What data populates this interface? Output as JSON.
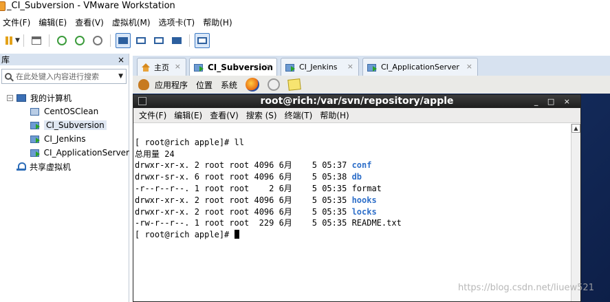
{
  "window": {
    "title": "_CI_Subversion - VMware Workstation"
  },
  "menu": [
    "文件(F)",
    "编辑(E)",
    "查看(V)",
    "虚拟机(M)",
    "选项卡(T)",
    "帮助(H)"
  ],
  "toolbar": {
    "icons": [
      "pause-icon",
      "network-icon",
      "snapshot-icon",
      "revert-snapshot-icon",
      "snapshot-manager-icon",
      "show-library-icon",
      "console-view-icon",
      "full-screen-icon",
      "unity-icon",
      "thumbnail-icon"
    ]
  },
  "library": {
    "title": "库",
    "close_glyph": "×",
    "search_placeholder": "在此处键入内容进行搜索",
    "tree": {
      "root": "我的计算机",
      "root_toggle": "−",
      "vms": [
        "CentOSClean",
        "CI_Subversion",
        "CI_Jenkins",
        "CI_ApplicationServer"
      ],
      "shared": "共享虚拟机"
    }
  },
  "tabs": [
    {
      "label": "主页"
    },
    {
      "label": "CI_Subversion"
    },
    {
      "label": "CI_Jenkins"
    },
    {
      "label": "CI_ApplicationServer"
    }
  ],
  "tab_close_glyph": "×",
  "guest_panel": {
    "applications": "应用程序",
    "places": "位置",
    "system": "系统"
  },
  "terminal": {
    "title": "root@rich:/var/svn/repository/apple",
    "controls": "_ □ ×",
    "menu": [
      "文件(F)",
      "编辑(E)",
      "查看(V)",
      "搜索 (S)",
      "终端(T)",
      "帮助(H)"
    ],
    "prompt1": "[ root@rich apple]# ll",
    "total": "总用量 24",
    "rows": [
      {
        "perms": "drwxr-xr-x.",
        "links": "2",
        "owner": "root",
        "group": "root",
        "size": "4096",
        "month": "6月",
        "day": "5",
        "time": "05:37",
        "name": "conf",
        "is_dir": true
      },
      {
        "perms": "drwxr-sr-x.",
        "links": "6",
        "owner": "root",
        "group": "root",
        "size": "4096",
        "month": "6月",
        "day": "5",
        "time": "05:38",
        "name": "db",
        "is_dir": true
      },
      {
        "perms": "-r--r--r--.",
        "links": "1",
        "owner": "root",
        "group": "root",
        "size": "2",
        "month": "6月",
        "day": "5",
        "time": "05:35",
        "name": "format",
        "is_dir": false
      },
      {
        "perms": "drwxr-xr-x.",
        "links": "2",
        "owner": "root",
        "group": "root",
        "size": "4096",
        "month": "6月",
        "day": "5",
        "time": "05:35",
        "name": "hooks",
        "is_dir": true
      },
      {
        "perms": "drwxr-xr-x.",
        "links": "2",
        "owner": "root",
        "group": "root",
        "size": "4096",
        "month": "6月",
        "day": "5",
        "time": "05:35",
        "name": "locks",
        "is_dir": true
      },
      {
        "perms": "-rw-r--r--.",
        "links": "1",
        "owner": "root",
        "group": "root",
        "size": "229",
        "month": "6月",
        "day": "5",
        "time": "05:35",
        "name": "README.txt",
        "is_dir": false
      }
    ],
    "prompt2": "[ root@rich apple]# "
  },
  "watermark": "https://blog.csdn.net/liuew521",
  "colors": {
    "dir": "#2e6fc9",
    "accent": "#3a78c4",
    "desktop": "#1e3d78"
  }
}
